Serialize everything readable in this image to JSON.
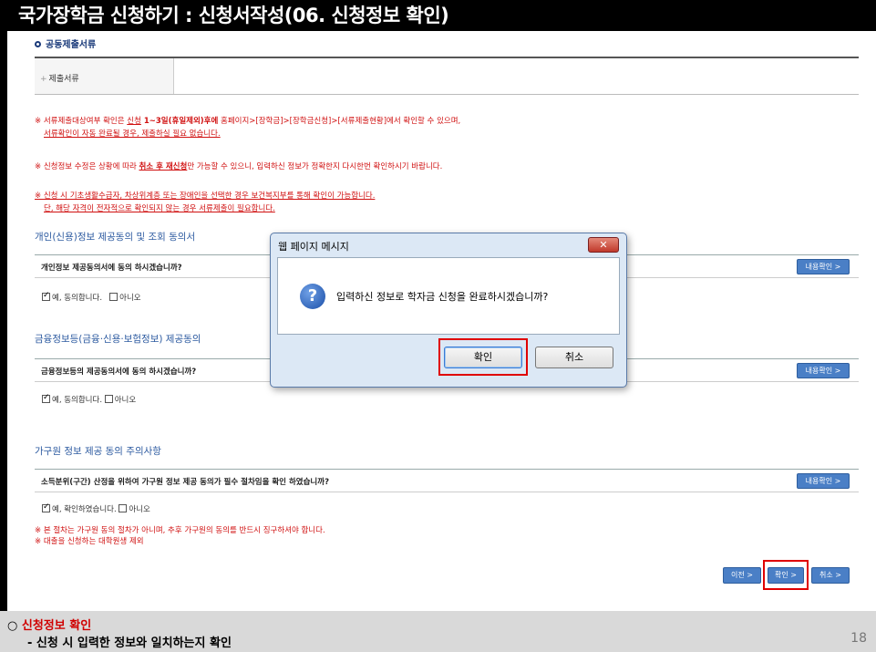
{
  "slide": {
    "title": "국가장학금 신청하기 : 신청서작성(06. 신청정보 확인)",
    "page_number": "18"
  },
  "docs": {
    "section_title": "공동제출서류",
    "row_label": "제출서류"
  },
  "notices": {
    "n1_a": "※ 서류제출대상여부 확인은 ",
    "n1_b": "신청",
    "n1_c": " 1~3일(휴일제외)후에",
    "n1_d": " 홈페이지>[장학금]>[장학금신청]>[서류제출현황]에서 확인할 수 있으며,",
    "n1_line2": "서류확인이 자동 완료될 경우, 제출하실 필요 없습니다.",
    "n2_a": "※ 신청정보 수정은 상황에 따라 ",
    "n2_b": "취소 후 재신청",
    "n2_c": "만 가능할 수 있으니, 입력하신 정보가 정확한지 다시한번 확인하시기 바랍니다.",
    "n3_line1": "※ 신청 시 기초생활수급자, 차상위계층 또는 장애인을 선택한 경우 보건복지부를 통해 확인이 가능합니다.",
    "n3_line2": "단, 해당 자격이 전자적으로 확인되지 않는 경우 서류제출이 필요합니다."
  },
  "consent_personal": {
    "title": "개인(신용)정보 제공동의 및 조회 동의서",
    "question": "개인정보 제공동의서에 동의 하시겠습니까?",
    "detail_button": "내용확인 >",
    "yes": "예, 동의합니다.",
    "no": "아니오"
  },
  "consent_finance": {
    "title": "금융정보등(금융·신용·보험정보) 제공동의",
    "question": "금융정보등의 제공동의서에 동의 하시겠습니까?",
    "detail_button": "내용확인 >",
    "yes": "예, 동의합니다.",
    "no": "아니오"
  },
  "consent_household": {
    "title": "가구원 정보 제공 동의 주의사항",
    "question": "소득분위(구간) 산정을 위하여 가구원 정보 제공 동의가 필수 절차임을 확인 하였습니까?",
    "detail_button": "내용확인 >",
    "yes": "예, 확인하였습니다.",
    "no": "아니오",
    "note1": "※ 본 절차는 가구원 동의 절차가 아니며, 추후 가구원의 동의를 반드시 징구하셔야 합니다.",
    "note2": "※ 대출을 신청하는 대학원생 제외"
  },
  "nav": {
    "prev": "이전 >",
    "confirm": "확인 >",
    "cancel": "취소 >"
  },
  "dialog": {
    "title": "웹 페이지 메시지",
    "close": "✕",
    "icon": "?",
    "message": "입력하신 정보로 학자금 신청을 완료하시겠습니까?",
    "ok": "확인",
    "cancel": "취소"
  },
  "footer": {
    "circle": "○ ",
    "heading": "신청정보 확인",
    "sub": "- 신청 시 입력한 정보와 일치하는지 확인"
  },
  "colors": {
    "highlight": "#e00000",
    "button_blue": "#4a7fc6",
    "notice_red": "#d01010"
  }
}
